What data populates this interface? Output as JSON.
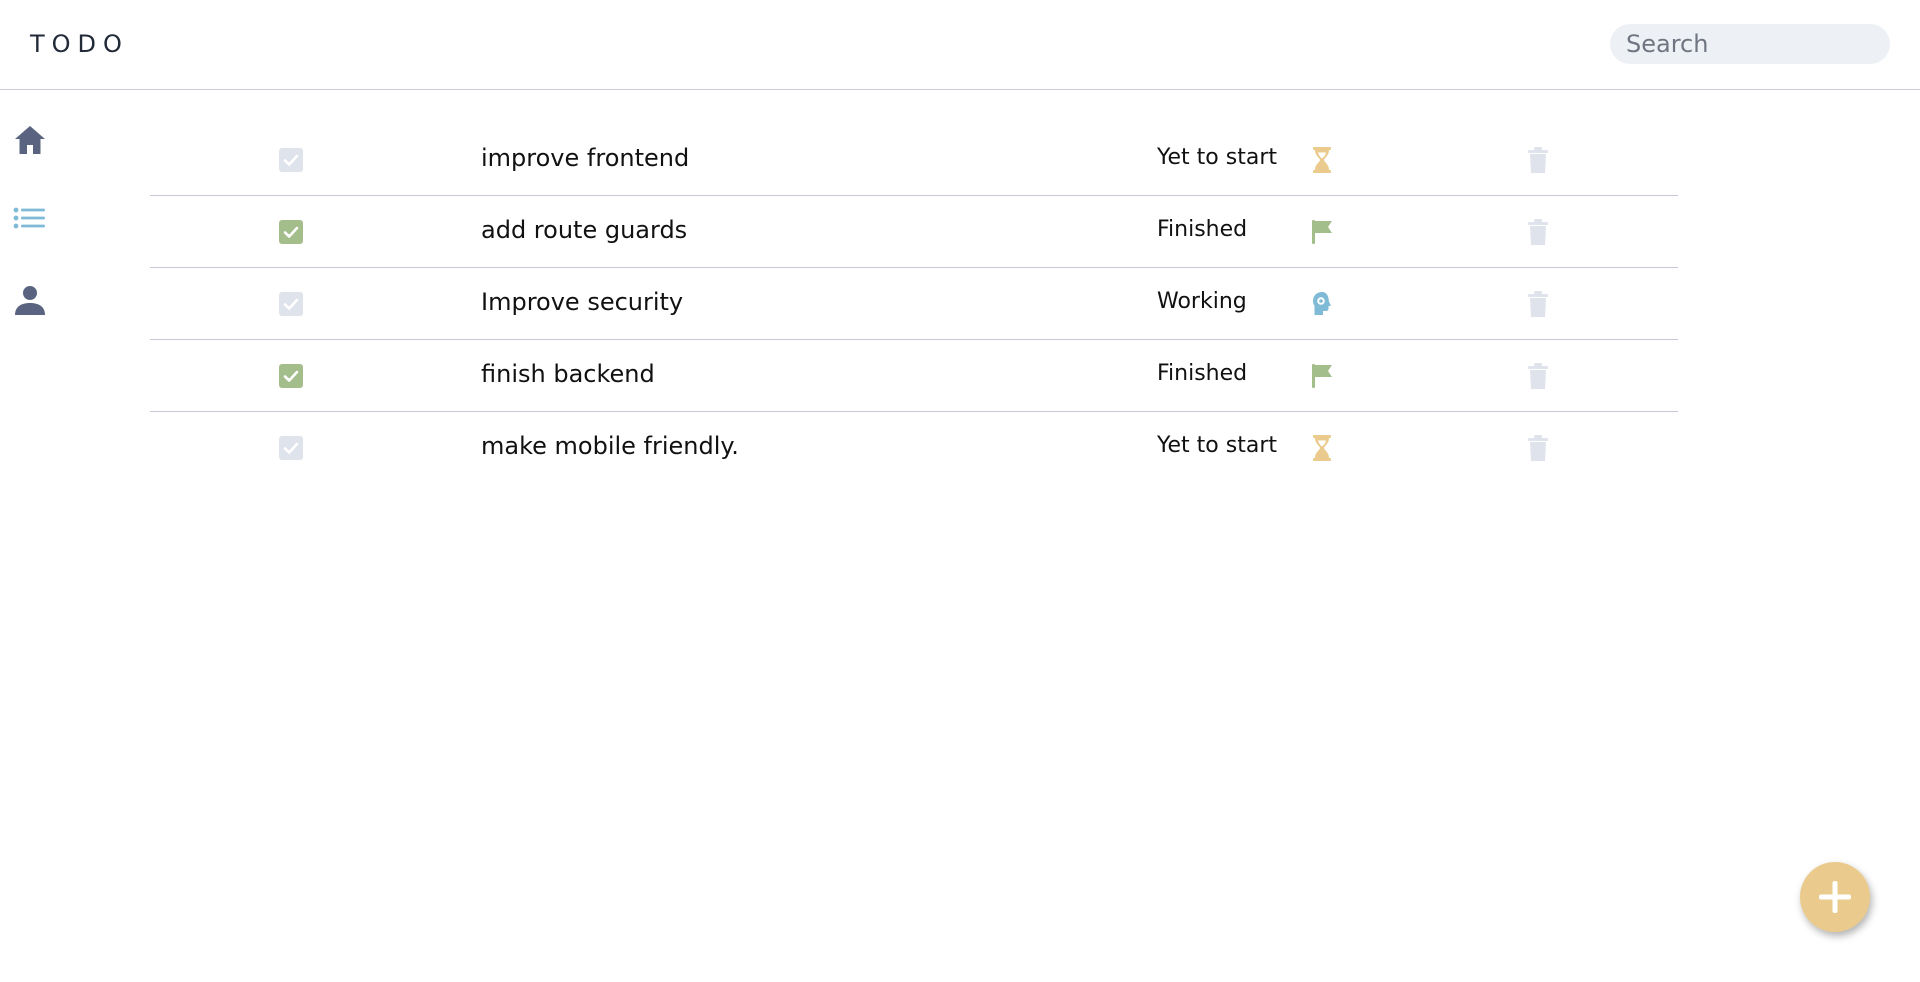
{
  "app": {
    "title": "TODO"
  },
  "search": {
    "placeholder": "Search",
    "value": ""
  },
  "sidebar": {
    "items": [
      {
        "icon": "home-icon",
        "color": "#5a6480",
        "active": false
      },
      {
        "icon": "list-icon",
        "color": "#7fbad6",
        "active": true
      },
      {
        "icon": "user-icon",
        "color": "#5a6480",
        "active": false
      }
    ]
  },
  "tasks": [
    {
      "title": "improve frontend",
      "status": "Yet to start",
      "done": false,
      "status_icon": "hourglass-icon"
    },
    {
      "title": "add route guards",
      "status": "Finished",
      "done": true,
      "status_icon": "flag-icon"
    },
    {
      "title": "Improve security",
      "status": "Working",
      "done": false,
      "status_icon": "gear-head-icon"
    },
    {
      "title": "finish backend",
      "status": "Finished",
      "done": true,
      "status_icon": "flag-icon"
    },
    {
      "title": "make mobile friendly.",
      "status": "Yet to start",
      "done": false,
      "status_icon": "hourglass-icon"
    }
  ],
  "colors": {
    "checked": "#a3bd8b",
    "unchecked": "#dfe3ec",
    "hourglass": "#eacb8d",
    "flag": "#a3bd8b",
    "working": "#7fbad6",
    "trash": "#dfe3ec",
    "fab": "#eacb8d"
  },
  "fab": {
    "icon": "plus-icon"
  }
}
